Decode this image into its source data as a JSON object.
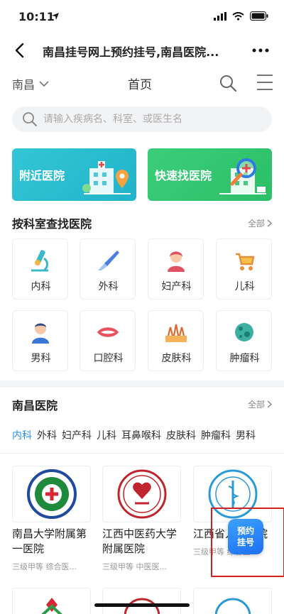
{
  "status": {
    "time": "10:11"
  },
  "nav": {
    "title": "南昌挂号网上预约挂号,南昌医院..."
  },
  "header": {
    "city": "南昌",
    "title": "首页"
  },
  "search": {
    "placeholder": "请输入疾病名、科室、或医生名"
  },
  "banners": [
    {
      "label": "附近医院"
    },
    {
      "label": "快速找医院"
    }
  ],
  "departments": {
    "title": "按科室查找医院",
    "all_label": "全部",
    "items": [
      {
        "label": "内科",
        "icon": "microscope-icon"
      },
      {
        "label": "外科",
        "icon": "scalpel-icon"
      },
      {
        "label": "妇产科",
        "icon": "woman-icon"
      },
      {
        "label": "儿科",
        "icon": "stroller-icon"
      },
      {
        "label": "男科",
        "icon": "man-icon"
      },
      {
        "label": "口腔科",
        "icon": "mouth-icon"
      },
      {
        "label": "皮肤科",
        "icon": "skin-icon"
      },
      {
        "label": "肿瘤科",
        "icon": "tumor-icon"
      }
    ]
  },
  "hospitals": {
    "title": "南昌医院",
    "all_label": "全部",
    "tabs": [
      "内科",
      "外科",
      "妇产科",
      "儿科",
      "耳鼻喉科",
      "皮肤科",
      "肿瘤科",
      "男科"
    ],
    "active_tab": 0,
    "cards": [
      {
        "name": "南昌大学附属第一医院",
        "meta": "三级甲等 综合医..."
      },
      {
        "name": "江西中医药大学附属医院",
        "meta": "三级甲等 中医医..."
      },
      {
        "name": "江西省人民医院",
        "meta": "三级甲等 综合医"
      }
    ]
  },
  "floating_button": {
    "line1": "预约",
    "line2": "挂号"
  },
  "colors": {
    "accent": "#2b8fe6",
    "banner_nearby": "#26b9cd",
    "banner_fast": "#33c670",
    "highlight": "#d32020"
  }
}
